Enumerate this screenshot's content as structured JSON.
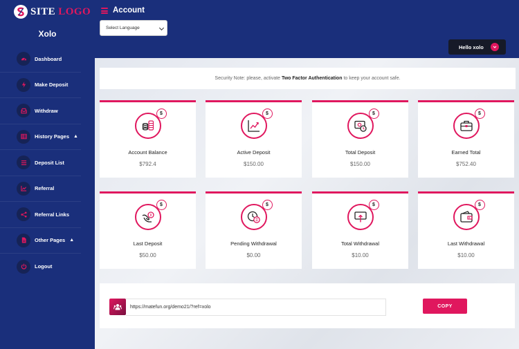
{
  "brand": {
    "site": "SITE",
    "logo": "LOGO"
  },
  "sidebar": {
    "username": "Xolo",
    "items": [
      {
        "label": "Dashboard",
        "icon": "gauge-icon"
      },
      {
        "label": "Make Deposit",
        "icon": "bolt-icon"
      },
      {
        "label": "Withdraw",
        "icon": "inbox-icon"
      },
      {
        "label": "History Pages",
        "icon": "table-icon",
        "chevron": "up"
      },
      {
        "label": "Deposit List",
        "icon": "list-icon"
      },
      {
        "label": "Referral",
        "icon": "chart-icon"
      },
      {
        "label": "Referral Links",
        "icon": "share-icon"
      },
      {
        "label": "Other Pages",
        "icon": "file-icon",
        "chevron": "up"
      },
      {
        "label": "Logout",
        "icon": "power-icon"
      }
    ]
  },
  "header": {
    "title": "Account",
    "language_select": "Select Language",
    "greeting": "Hello xolo"
  },
  "security": {
    "prefix": "Security Note: please, activate",
    "highlight": "Two Factor Authentication",
    "suffix": "to keep your account safe."
  },
  "cards": [
    {
      "title": "Account Balance",
      "value": "$792.4",
      "icon": "coins-icon"
    },
    {
      "title": "Active Deposit",
      "value": "$150.00",
      "icon": "growth-chart-icon"
    },
    {
      "title": "Total Deposit",
      "value": "$150.00",
      "icon": "cash-clock-icon"
    },
    {
      "title": "Earned Total",
      "value": "$752.40",
      "icon": "briefcase-icon"
    },
    {
      "title": "Last Deposit",
      "value": "$50.00",
      "icon": "hand-coin-icon"
    },
    {
      "title": "Pending Withdrawal",
      "value": "$0.00",
      "icon": "clock-coin-icon"
    },
    {
      "title": "Total Withdrawal",
      "value": "$10.00",
      "icon": "withdraw-cash-icon"
    },
    {
      "title": "Last Withdrawal",
      "value": "$10.00",
      "icon": "wallet-icon"
    }
  ],
  "dollar_badge": "$",
  "referral": {
    "link": "https://matefun.org/demo21/?ref=xolo",
    "copy_label": "COPY",
    "icon": "users-icon"
  },
  "colors": {
    "accent": "#e0175e",
    "sidebar": "#1a2f7b",
    "dark_button": "#161a28"
  }
}
